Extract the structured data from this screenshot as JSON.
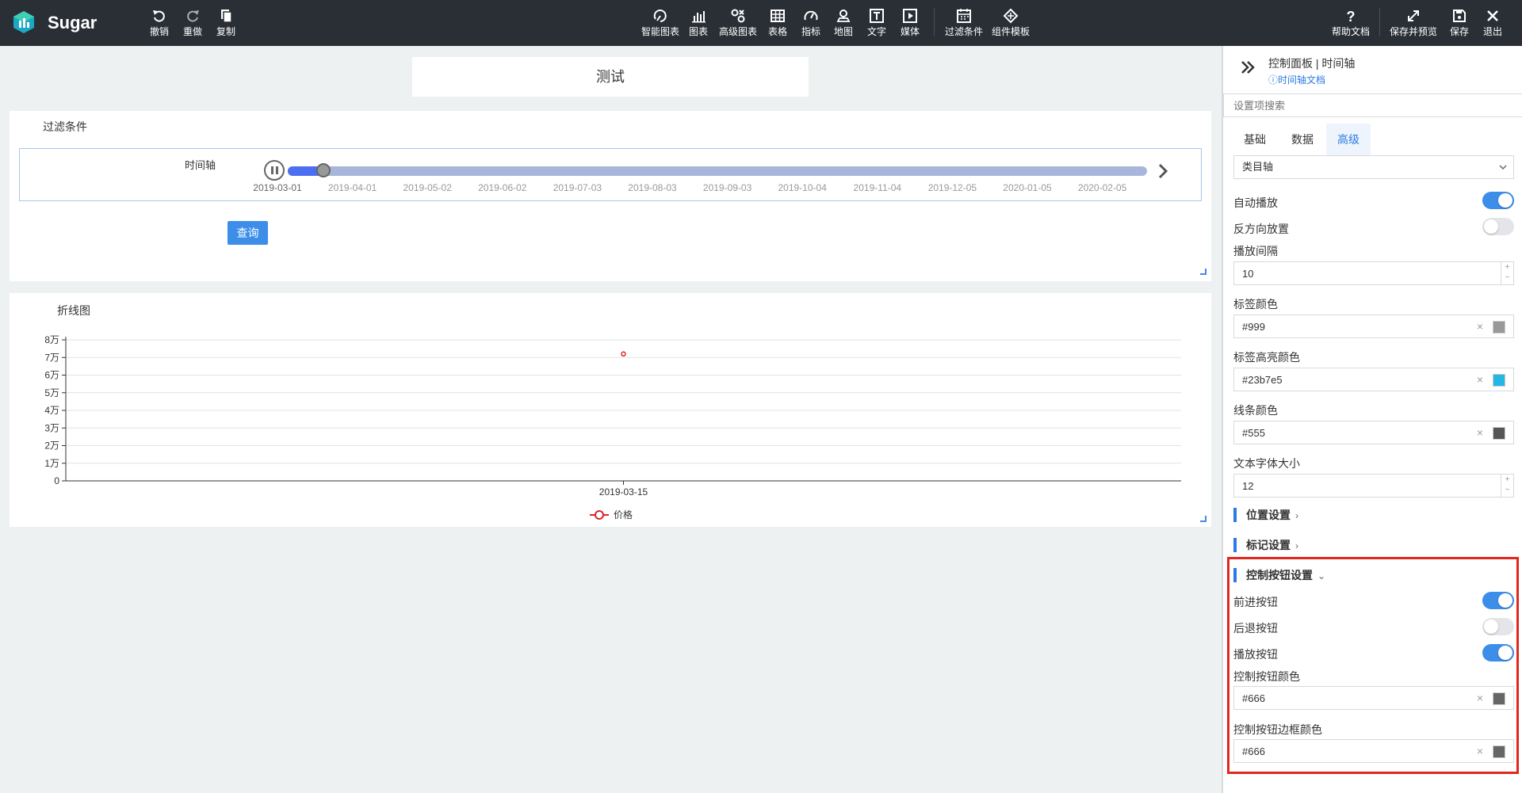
{
  "app": {
    "brand": "Sugar"
  },
  "toolbar": {
    "left": [
      {
        "label": "撤销",
        "icon": "undo-icon"
      },
      {
        "label": "重做",
        "icon": "redo-icon"
      },
      {
        "label": "复制",
        "icon": "copy-icon"
      }
    ],
    "center": [
      {
        "label": "智能图表",
        "icon": "smart-chart-icon"
      },
      {
        "label": "图表",
        "icon": "bar-chart-icon"
      },
      {
        "label": "高级图表",
        "icon": "advanced-chart-icon"
      },
      {
        "label": "表格",
        "icon": "table-icon"
      },
      {
        "label": "指标",
        "icon": "gauge-icon"
      },
      {
        "label": "地图",
        "icon": "map-pin-icon"
      },
      {
        "label": "文字",
        "icon": "text-icon"
      },
      {
        "label": "媒体",
        "icon": "media-icon"
      },
      {
        "label": "过滤条件",
        "icon": "filter-calendar-icon"
      },
      {
        "label": "组件模板",
        "icon": "template-icon"
      }
    ],
    "right": [
      {
        "label": "帮助文档",
        "icon": "help-icon"
      },
      {
        "label": "保存并预览",
        "icon": "expand-icon"
      },
      {
        "label": "保存",
        "icon": "save-icon"
      },
      {
        "label": "退出",
        "icon": "close-icon"
      }
    ]
  },
  "canvas": {
    "title": "测试",
    "filter_panel": {
      "title": "过滤条件",
      "timeline_label": "时间轴",
      "ticks": [
        "2019-03-01",
        "2019-04-01",
        "2019-05-02",
        "2019-06-02",
        "2019-07-03",
        "2019-08-03",
        "2019-09-03",
        "2019-10-04",
        "2019-11-04",
        "2019-12-05",
        "2020-01-05",
        "2020-02-05"
      ],
      "current_index": 0,
      "progress_fraction": 0.037,
      "query_button": "查询"
    },
    "chart_panel": {
      "title": "折线图"
    }
  },
  "chart_data": {
    "type": "line",
    "title": "折线图",
    "categories": [
      "2019-03-15"
    ],
    "series": [
      {
        "name": "价格",
        "values": [
          72000
        ],
        "color": "#d62728"
      }
    ],
    "y_ticks": [
      "0",
      "1万",
      "2万",
      "3万",
      "4万",
      "5万",
      "6万",
      "7万",
      "8万"
    ],
    "ylim": [
      0,
      80000
    ],
    "grid": true,
    "legend": "bottom-center"
  },
  "side": {
    "title": "控制面板 | 时间轴",
    "doc_link": "ⓘ时间轴文档",
    "search_placeholder": "设置项搜索",
    "tabs": [
      "基础",
      "数据",
      "高级"
    ],
    "active_tab": 2,
    "axis_type": "类目轴",
    "autoplay_label": "自动播放",
    "autoplay_on": true,
    "reverse_label": "反方向放置",
    "reverse_on": false,
    "interval_label": "播放间隔",
    "interval_value": "10",
    "label_color_label": "标签颜色",
    "label_color": "#999",
    "label_highlight_label": "标签高亮颜色",
    "label_highlight_color": "#23b7e5",
    "line_color_label": "线条颜色",
    "line_color": "#555",
    "font_size_label": "文本字体大小",
    "font_size_value": "12",
    "position_section": "位置设置",
    "marker_section": "标记设置",
    "control_section": "控制按钮设置",
    "forward_label": "前进按钮",
    "forward_on": true,
    "backward_label": "后退按钮",
    "backward_on": false,
    "play_label": "播放按钮",
    "play_on": true,
    "ctrl_color_label": "控制按钮颜色",
    "ctrl_color": "#666",
    "ctrl_border_label": "控制按钮边框颜色",
    "ctrl_border_color": "#666",
    "spin_up": "+",
    "spin_down": "−",
    "clear_glyph": "×"
  }
}
